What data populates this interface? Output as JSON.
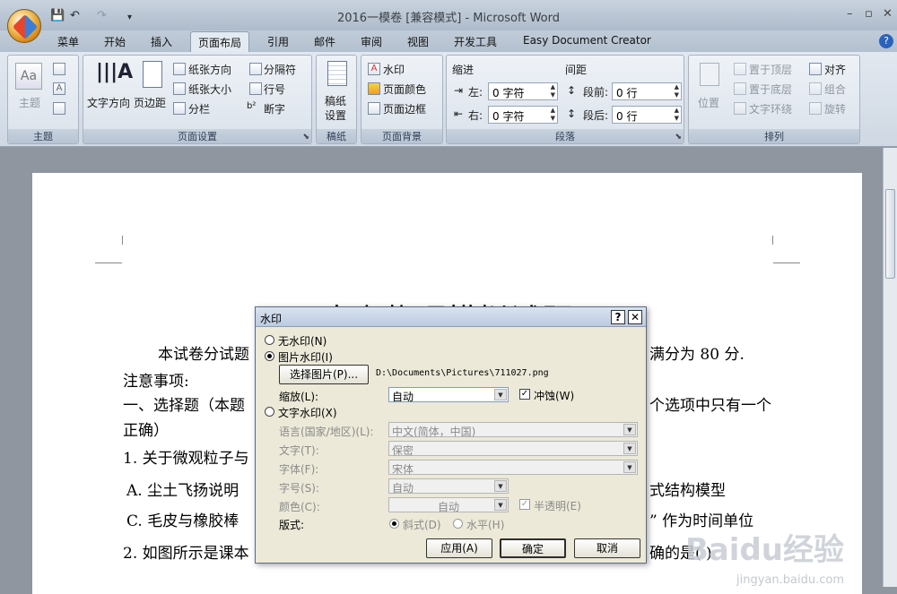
{
  "window": {
    "title": "2016一模卷 [兼容模式] - Microsoft Word"
  },
  "qat": {
    "undo": "↶",
    "redo": "↷"
  },
  "tabs": [
    {
      "label": "菜单"
    },
    {
      "label": "开始"
    },
    {
      "label": "插入"
    },
    {
      "label": "页面布局"
    },
    {
      "label": "引用"
    },
    {
      "label": "邮件"
    },
    {
      "label": "审阅"
    },
    {
      "label": "视图"
    },
    {
      "label": "开发工具"
    },
    {
      "label": "Easy Document Creator"
    }
  ],
  "ribbon": {
    "theme_group": {
      "label": "主题",
      "theme": "主题"
    },
    "page_setup": {
      "label": "页面设置",
      "text_direction": "文字方向",
      "margins": "页边距",
      "orientation": "纸张方向",
      "size": "纸张大小",
      "columns": "分栏",
      "breaks": "分隔符",
      "line_numbers": "行号",
      "hyphenation": "断字"
    },
    "manuscript": {
      "label": "稿纸",
      "setup": "稿纸设置",
      "line1": "稿纸",
      "line2": "设置"
    },
    "page_background": {
      "label": "页面背景",
      "watermark": "水印",
      "page_color": "页面颜色",
      "page_borders": "页面边框"
    },
    "paragraph": {
      "label": "段落",
      "indent": "缩进",
      "spacing": "间距",
      "left_label": "左:",
      "left_value": "0 字符",
      "right_label": "右:",
      "right_value": "0 字符",
      "before_label": "段前:",
      "before_value": "0 行",
      "after_label": "段后:",
      "after_value": "0 行"
    },
    "arrange": {
      "label": "排列",
      "position": "位置",
      "bring_front": "置于顶层",
      "send_back": "置于底层",
      "text_wrap": "文字环绕",
      "align": "对齐",
      "group": "组合",
      "rotate": "旋转"
    }
  },
  "document": {
    "title": "中考物理模拟试题",
    "line1_left": "本试卷分试题",
    "line1_right": "满分为 80 分.",
    "line2": "注意事项:",
    "line3_left": "一、选择题（本题",
    "line3_right": "个选项中只有一个",
    "line4": "正确）",
    "line5": "1. 关于微观粒子与",
    "line6_left": "A. 尘土飞扬说明",
    "line6_right": "式结构模型",
    "line7_left": "C. 毛皮与橡胶棒",
    "line7_right": "” 作为时间单位",
    "line8_left": "2. 如图所示是课本",
    "line8_right": "确的是(     )"
  },
  "watermark_brand": {
    "text": "Baidu经验",
    "url": "jingyan.baidu.com"
  },
  "dialog": {
    "title": "水印",
    "help": "?",
    "close": "✕",
    "no_watermark": "无水印(N)",
    "picture_watermark": "图片水印(I)",
    "select_picture": "选择图片(P)...",
    "picture_path": "D:\\Documents\\Pictures\\711027.png",
    "scale_label": "缩放(L):",
    "scale_value": "自动",
    "washout": "冲蚀(W)",
    "text_watermark": "文字水印(X)",
    "language_label": "语言(国家/地区)(L):",
    "language_value": "中文(简体，中国)",
    "text_label": "文字(T):",
    "text_value": "保密",
    "font_label": "字体(F):",
    "font_value": "宋体",
    "size_label": "字号(S):",
    "size_value": "自动",
    "color_label": "颜色(C):",
    "color_value": "自动",
    "semitransparent": "半透明(E)",
    "layout_label": "版式:",
    "diagonal": "斜式(D)",
    "horizontal": "水平(H)",
    "apply": "应用(A)",
    "ok": "确定",
    "cancel": "取消"
  }
}
